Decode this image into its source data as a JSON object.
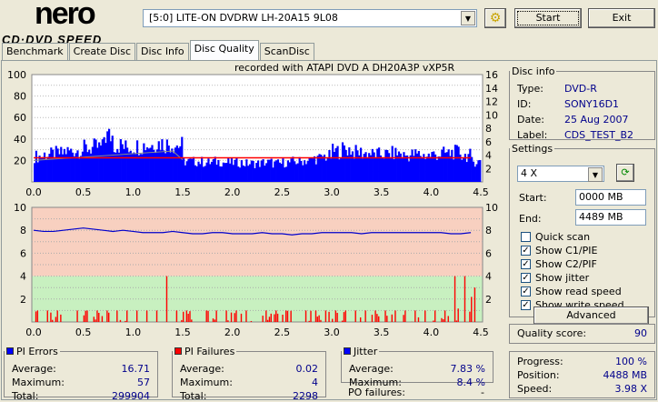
{
  "app": {
    "logo_top": "nero",
    "logo_bottom": "CD·DVD SPEED"
  },
  "toolbar": {
    "drive": "[5:0]  LITE-ON DVDRW LH-20A15 9L08",
    "start": "Start",
    "exit": "Exit"
  },
  "tabs": [
    "Benchmark",
    "Create Disc",
    "Disc Info",
    "Disc Quality",
    "ScanDisc"
  ],
  "recorded": "recorded with ATAPI   DVD A   DH20A3P    vXP5R",
  "disc_info": {
    "title": "Disc info",
    "rows": [
      [
        "Type:",
        "DVD-R"
      ],
      [
        "ID:",
        "SONY16D1"
      ],
      [
        "Date:",
        "25 Aug 2007"
      ],
      [
        "Label:",
        "CDS_TEST_B2"
      ]
    ]
  },
  "settings": {
    "title": "Settings",
    "speed": "4 X",
    "start_label": "Start:",
    "start": "0000 MB",
    "end_label": "End:",
    "end": "4489 MB",
    "checks": [
      {
        "label": "Quick scan",
        "checked": false
      },
      {
        "label": "Show C1/PIE",
        "checked": true
      },
      {
        "label": "Show C2/PIF",
        "checked": true
      },
      {
        "label": "Show jitter",
        "checked": true
      },
      {
        "label": "Show read speed",
        "checked": true
      },
      {
        "label": "Show write speed",
        "checked": true
      }
    ],
    "advanced": "Advanced"
  },
  "quality": {
    "label": "Quality score:",
    "value": "90"
  },
  "progress": {
    "rows": [
      [
        "Progress:",
        "100 %"
      ],
      [
        "Position:",
        "4488 MB"
      ],
      [
        "Speed:",
        "3.98 X"
      ]
    ]
  },
  "pi_errors": {
    "title": "PI Errors",
    "color": "#0000ff",
    "rows": [
      [
        "Average:",
        "16.71"
      ],
      [
        "Maximum:",
        "57"
      ],
      [
        "Total:",
        "299904"
      ]
    ]
  },
  "pi_failures": {
    "title": "PI Failures",
    "color": "#ff0000",
    "rows": [
      [
        "Average:",
        "0.02"
      ],
      [
        "Maximum:",
        "4"
      ],
      [
        "Total:",
        "2298"
      ]
    ]
  },
  "jitter": {
    "title": "Jitter",
    "color": "#0000ff",
    "rows": [
      [
        "Average:",
        "7.83 %"
      ],
      [
        "Maximum:",
        "8.4 %"
      ]
    ]
  },
  "po_failures": {
    "label": "PO failures:",
    "value": "-"
  },
  "chart_data": [
    {
      "type": "bar",
      "title": "PI Errors",
      "x_ticks": [
        "0.0",
        "0.5",
        "1.0",
        "1.5",
        "2.0",
        "2.5",
        "3.0",
        "3.5",
        "4.0",
        "4.5"
      ],
      "xlim": [
        0,
        4.5
      ],
      "ylim_left": [
        0,
        100
      ],
      "y_ticks_left": [
        "100",
        "80",
        "60",
        "40",
        "20"
      ],
      "ylim_right": [
        0,
        16
      ],
      "y_ticks_right": [
        "16",
        "14",
        "12",
        "10",
        "8",
        "6",
        "4",
        "2"
      ],
      "x_step": 0.1,
      "values": [
        25,
        27,
        28,
        30,
        31,
        33,
        34,
        45,
        36,
        34,
        35,
        36,
        38,
        37,
        36,
        20,
        20,
        19,
        20,
        19,
        19,
        18,
        18,
        19,
        18,
        19,
        20,
        21,
        23,
        25,
        30,
        32,
        29,
        28,
        27,
        27,
        28,
        26,
        27,
        26,
        27,
        28,
        29,
        26,
        20
      ],
      "read_speed": [
        3.2,
        3.3,
        3.4,
        3.5,
        3.6,
        3.7,
        3.8,
        3.9,
        4.0,
        4.1,
        4.2,
        4.3,
        4.4,
        4.5,
        4.6,
        3.3
      ],
      "write_speed": 3.6
    },
    {
      "type": "bar",
      "title": "PI Failures / Jitter",
      "x_ticks": [
        "0.0",
        "0.5",
        "1.0",
        "1.5",
        "2.0",
        "2.5",
        "3.0",
        "3.5",
        "4.0",
        "4.5"
      ],
      "xlim": [
        0,
        4.5
      ],
      "ylim_left": [
        0,
        10
      ],
      "y_ticks_left": [
        "10",
        "8",
        "6",
        "4",
        "2"
      ],
      "ylim_right": [
        0,
        10
      ],
      "y_ticks_right": [
        "10",
        "8",
        "6",
        "4",
        "2"
      ],
      "x_step": 0.1,
      "values": [
        1,
        1,
        1,
        0,
        1,
        1,
        1,
        1,
        1,
        1,
        1,
        1,
        1,
        4,
        1,
        1,
        0,
        1,
        1,
        1,
        1,
        1,
        0,
        1,
        1,
        1,
        0,
        1,
        1,
        1,
        1,
        1,
        1,
        1,
        1,
        1,
        1,
        1,
        1,
        1,
        1,
        1,
        4,
        4,
        3
      ],
      "jitter": [
        8.0,
        7.9,
        7.9,
        8.0,
        8.1,
        8.2,
        8.1,
        8.0,
        7.9,
        8.0,
        7.9,
        7.8,
        7.8,
        7.8,
        7.9,
        7.8,
        7.7,
        7.7,
        7.8,
        7.8,
        7.7,
        7.7,
        7.7,
        7.8,
        7.7,
        7.7,
        7.6,
        7.7,
        7.7,
        7.8,
        7.8,
        7.8,
        7.8,
        7.7,
        7.8,
        7.8,
        7.8,
        7.8,
        7.8,
        7.8,
        7.8,
        7.8,
        7.7,
        7.7,
        7.8
      ]
    }
  ]
}
